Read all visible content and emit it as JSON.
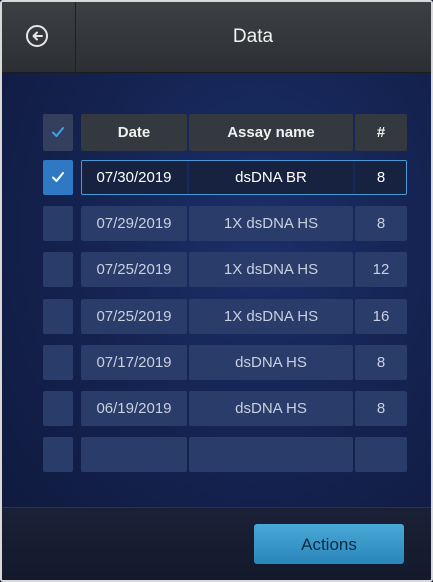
{
  "header": {
    "title": "Data"
  },
  "table": {
    "columns": [
      "Date",
      "Assay name",
      "#"
    ],
    "rows": [
      {
        "date": "07/30/2019",
        "assay": "dsDNA BR",
        "count": "8",
        "checked": true
      },
      {
        "date": "07/29/2019",
        "assay": "1X dsDNA HS",
        "count": "8",
        "checked": false
      },
      {
        "date": "07/25/2019",
        "assay": "1X dsDNA HS",
        "count": "12",
        "checked": false
      },
      {
        "date": "07/25/2019",
        "assay": "1X dsDNA HS",
        "count": "16",
        "checked": false
      },
      {
        "date": "07/17/2019",
        "assay": "dsDNA HS",
        "count": "8",
        "checked": false
      },
      {
        "date": "06/19/2019",
        "assay": "dsDNA HS",
        "count": "8",
        "checked": false
      },
      {
        "date": "",
        "assay": "",
        "count": "",
        "checked": false
      }
    ]
  },
  "footer": {
    "actions_label": "Actions"
  },
  "colors": {
    "accent": "#2f79c4",
    "button": "#3a98c9",
    "background": "#14224f"
  },
  "icons": {
    "back": "back-arrow-circle-icon",
    "check": "checkmark-icon"
  }
}
